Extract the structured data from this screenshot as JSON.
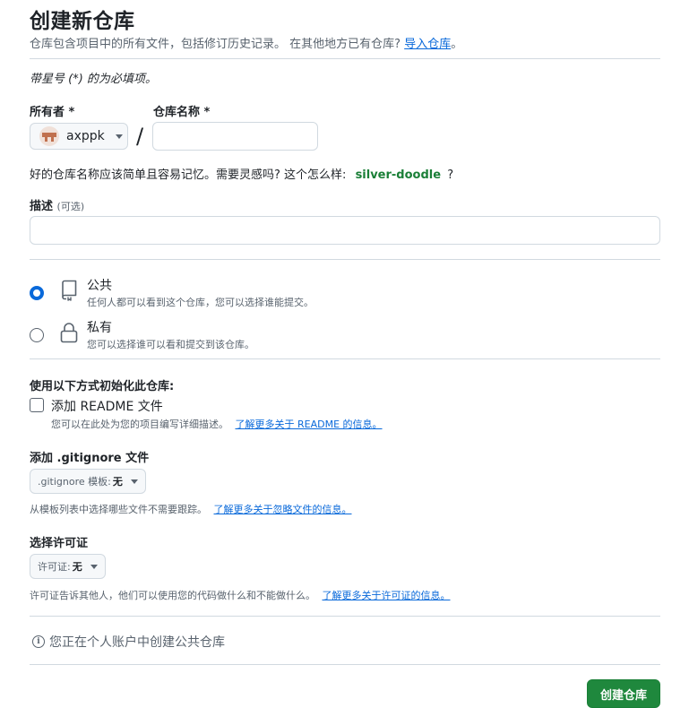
{
  "header": {
    "title": "创建新仓库",
    "subtitle_text": "仓库包含项目中的所有文件，包括修订历史记录。 在其他地方已有仓库?",
    "import_link": "导入仓库",
    "subtitle_end": "。"
  },
  "required_note": "带星号 (*) 的为必填项。",
  "owner": {
    "label": "所有者 *",
    "value": "axppk"
  },
  "slash": "/",
  "repo_name": {
    "label": "仓库名称 *",
    "value": "",
    "hint_prefix": "好的仓库名称应该简单且容易记忆。需要灵感吗? 这个怎么样:",
    "suggestion": "silver-doodle",
    "hint_suffix": "?"
  },
  "description": {
    "label": "描述",
    "optional": "(可选)",
    "value": ""
  },
  "visibility": {
    "public": {
      "title": "公共",
      "desc": "任何人都可以看到这个仓库，您可以选择谁能提交。",
      "checked": true
    },
    "private": {
      "title": "私有",
      "desc": "您可以选择谁可以看和提交到该仓库。",
      "checked": false
    }
  },
  "init": {
    "heading": "使用以下方式初始化此仓库:",
    "readme_label": "添加 README 文件",
    "readme_desc": "您可以在此处为您的项目编写详细描述。",
    "readme_link": "了解更多关于 README 的信息。"
  },
  "gitignore": {
    "heading": "添加 .gitignore 文件",
    "select_prefix": ".gitignore 模板:",
    "select_value": "无",
    "desc": "从模板列表中选择哪些文件不需要跟踪。",
    "link": "了解更多关于忽略文件的信息。"
  },
  "license": {
    "heading": "选择许可证",
    "select_prefix": "许可证:",
    "select_value": "无",
    "desc": "许可证告诉其他人，他们可以使用您的代码做什么和不能做什么。",
    "link": "了解更多关于许可证的信息。"
  },
  "info_message": "您正在个人账户中创建公共仓库",
  "create_button": "创建仓库",
  "colors": {
    "primary_button": "#1f883d",
    "link": "#0969da",
    "radio_checked": "#0969da",
    "suggestion": "#1a7f37"
  }
}
